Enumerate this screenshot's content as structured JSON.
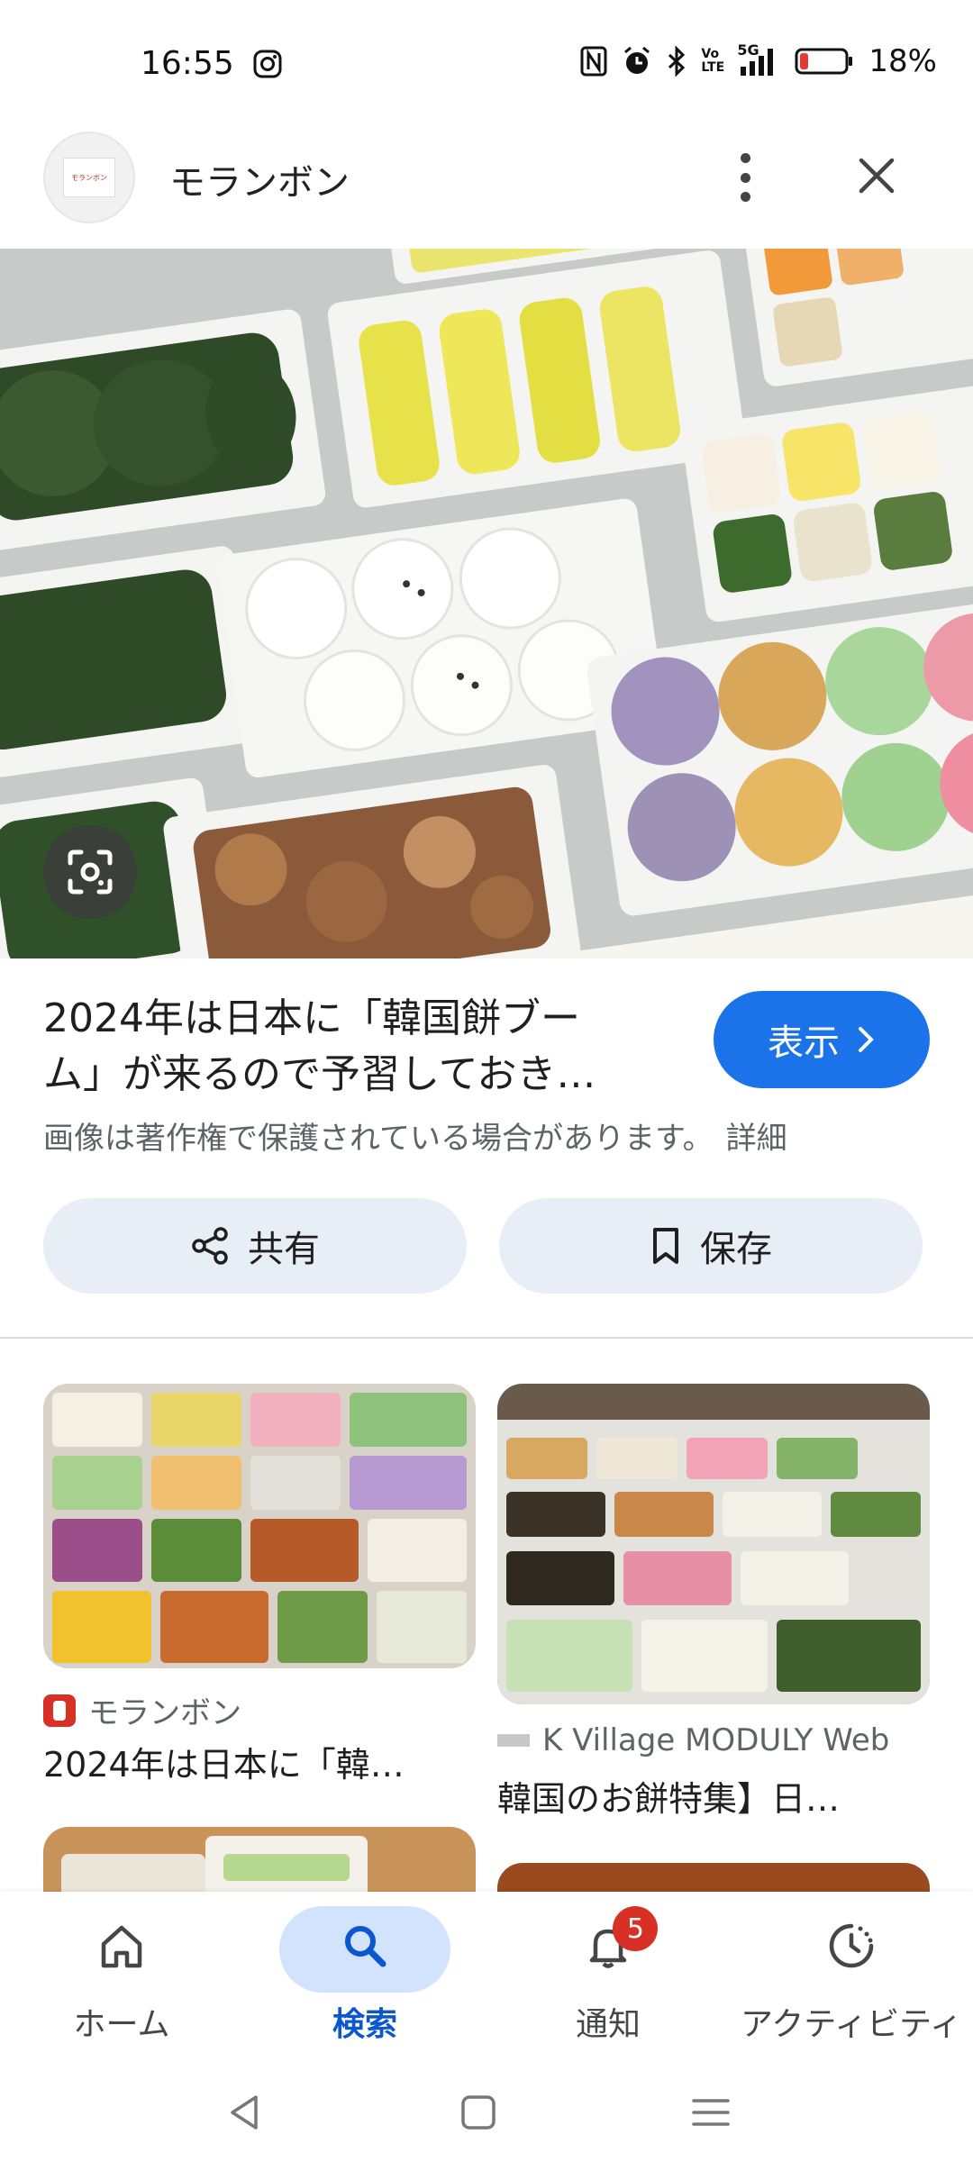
{
  "status_bar": {
    "time": "16:55",
    "battery_percent": "18%",
    "network": "5G",
    "volte": "Vo LTE",
    "battery_level": 0.18
  },
  "header": {
    "site_name": "モランボン",
    "avatar_text": "モランボン"
  },
  "result": {
    "title_line1": "2024年は日本に「韓国餅ブー",
    "title_line2": "ム」が来るので予習しておき…",
    "view_label": "表示",
    "copyright": "画像は著作権で保護されている場合があります。",
    "details_link": "詳細"
  },
  "actions": {
    "share_label": "共有",
    "save_label": "保存"
  },
  "related": [
    {
      "source": "モランボン",
      "title": "2024年は日本に「韓…"
    },
    {
      "source": "K Village MODULY Web",
      "title": "韓国のお餅特集】日…"
    }
  ],
  "bottom_nav": {
    "items": [
      {
        "label": "ホーム",
        "icon": "home-icon"
      },
      {
        "label": "検索",
        "icon": "search-icon",
        "active": true
      },
      {
        "label": "通知",
        "icon": "bell-icon",
        "badge": "5"
      },
      {
        "label": "アクティビティ",
        "icon": "activity-icon"
      }
    ]
  },
  "colors": {
    "accent": "#1a73e8",
    "active_nav": "#0b57d0",
    "pill_bg": "#d3e3fd",
    "badge": "#d93025"
  }
}
